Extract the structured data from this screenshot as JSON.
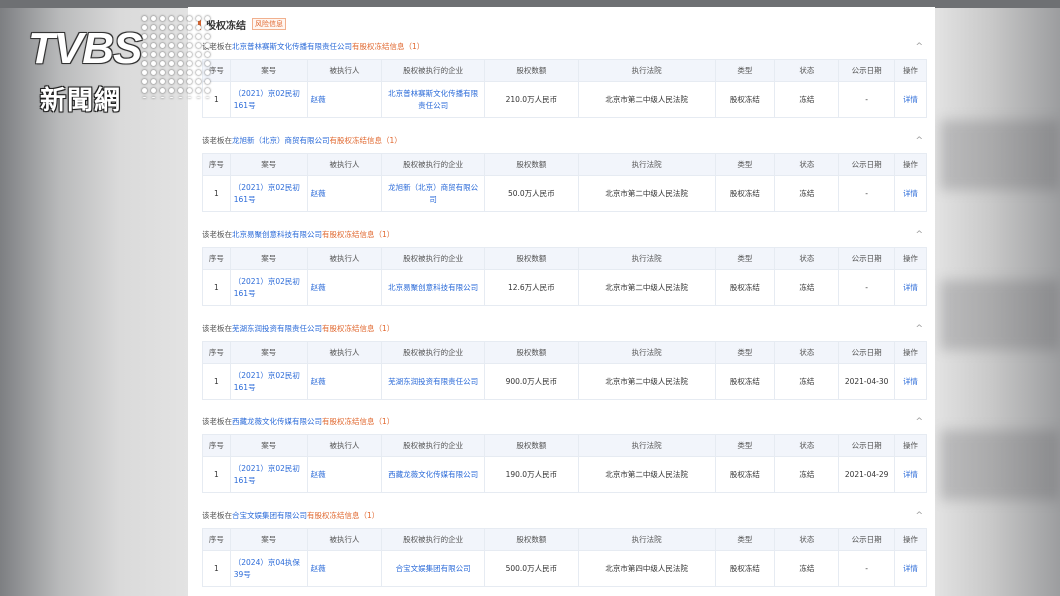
{
  "header": {
    "title": "股权冻结",
    "badge": "风险信息"
  },
  "watermark": {
    "brand": "TVBS",
    "channel": "新聞網"
  },
  "columns": [
    "序号",
    "案号",
    "被执行人",
    "股权被执行的企业",
    "股权数额",
    "执行法院",
    "类型",
    "状态",
    "公示日期",
    "操作"
  ],
  "sections": [
    {
      "prefix": "该老板在",
      "company": "北京普林赛斯文化传播有限责任公司",
      "suffix": "有股权冻结信息（1）",
      "chevron": "^",
      "row": {
        "no": "1",
        "case": "（2021）京02民初161号",
        "person": "赵薇",
        "firm": "北京普林赛斯文化传播有限责任公司",
        "amount": "210.0万人民币",
        "court": "北京市第二中级人民法院",
        "type": "股权冻结",
        "status": "冻结",
        "date": "-",
        "action": "详情"
      }
    },
    {
      "prefix": "该老板在",
      "company": "龙旭新（北京）商贸有限公司",
      "suffix": "有股权冻结信息（1）",
      "chevron": "^",
      "row": {
        "no": "1",
        "case": "（2021）京02民初161号",
        "person": "赵薇",
        "firm": "龙旭新（北京）商贸有限公司",
        "amount": "50.0万人民币",
        "court": "北京市第二中级人民法院",
        "type": "股权冻结",
        "status": "冻结",
        "date": "-",
        "action": "详情"
      }
    },
    {
      "prefix": "该老板在",
      "company": "北京易聚创意科技有限公司",
      "suffix": "有股权冻结信息（1）",
      "chevron": "^",
      "row": {
        "no": "1",
        "case": "（2021）京02民初161号",
        "person": "赵薇",
        "firm": "北京易聚创意科技有限公司",
        "amount": "12.6万人民币",
        "court": "北京市第二中级人民法院",
        "type": "股权冻结",
        "status": "冻结",
        "date": "-",
        "action": "详情"
      }
    },
    {
      "prefix": "该老板在",
      "company": "芜湖东润投资有限责任公司",
      "suffix": "有股权冻结信息（1）",
      "chevron": "^",
      "row": {
        "no": "1",
        "case": "（2021）京02民初161号",
        "person": "赵薇",
        "firm": "芜湖东润投资有限责任公司",
        "amount": "900.0万人民币",
        "court": "北京市第二中级人民法院",
        "type": "股权冻结",
        "status": "冻结",
        "date": "2021-04-30",
        "action": "详情"
      }
    },
    {
      "prefix": "该老板在",
      "company": "西藏龙薇文化传媒有限公司",
      "suffix": "有股权冻结信息（1）",
      "chevron": "^",
      "row": {
        "no": "1",
        "case": "（2021）京02民初161号",
        "person": "赵薇",
        "firm": "西藏龙薇文化传媒有限公司",
        "amount": "190.0万人民币",
        "court": "北京市第二中级人民法院",
        "type": "股权冻结",
        "status": "冻结",
        "date": "2021-04-29",
        "action": "详情"
      }
    },
    {
      "prefix": "该老板在",
      "company": "合宝文娱集团有限公司",
      "suffix": "有股权冻结信息（1）",
      "chevron": "^",
      "row": {
        "no": "1",
        "case": "（2024）京04执保39号",
        "person": "赵薇",
        "firm": "合宝文娱集团有限公司",
        "amount": "500.0万人民币",
        "court": "北京市第四中级人民法院",
        "type": "股权冻结",
        "status": "冻结",
        "date": "-",
        "action": "详情"
      }
    }
  ]
}
